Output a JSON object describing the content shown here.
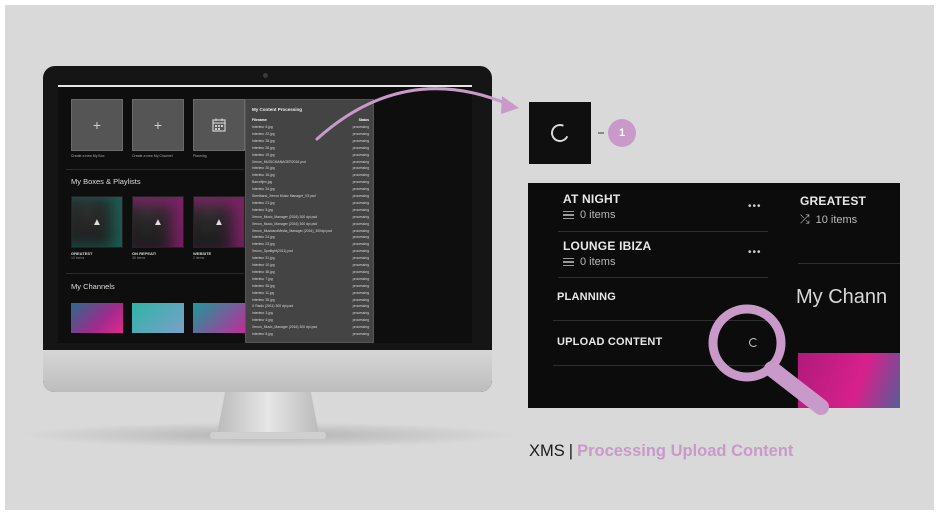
{
  "colors": {
    "accent": "#c99ac9",
    "background": "#d9d9d9",
    "screen": "#0e0e0e"
  },
  "screen": {
    "tiles": [
      {
        "icon": "+",
        "label": "Create a new My Box"
      },
      {
        "icon": "+",
        "label": "Create a new My Channel"
      },
      {
        "icon": "calendar-icon",
        "label": "Planning"
      }
    ],
    "boxes_heading": "My Boxes & Playlists",
    "boxes": [
      {
        "title": "GREATEST",
        "sub": "10 items"
      },
      {
        "title": "ON REPEAT!",
        "sub": "30 items"
      },
      {
        "title": "WEBSITE",
        "sub": "2 items"
      }
    ],
    "channels_heading": "My Channels",
    "panel": {
      "title": "My Content Processing",
      "header": {
        "name": "Filename",
        "status": "Status"
      },
      "files": [
        {
          "name": "Interieur 6.jpg",
          "status": "processing"
        },
        {
          "name": "Interieur 22.jpg",
          "status": "processing"
        },
        {
          "name": "Interieur 28.jpg",
          "status": "processing"
        },
        {
          "name": "Interieur 26.jpg",
          "status": "processing"
        },
        {
          "name": "Interieur 19.jpg",
          "status": "processing"
        },
        {
          "name": "Xenon_MUSICMANAGER2016.psd",
          "status": "processing"
        },
        {
          "name": "Interieur 20.jpg",
          "status": "processing"
        },
        {
          "name": "Interieur 16.jpg",
          "status": "processing"
        },
        {
          "name": "Barcelijen.jpg",
          "status": "processing"
        },
        {
          "name": "Interieur 34.jpg",
          "status": "processing"
        },
        {
          "name": "Steelband_Xenon Music Manager_V3.psd",
          "status": "processing"
        },
        {
          "name": "Interieur 21.jpg",
          "status": "processing"
        },
        {
          "name": "Interieur 5.jpg",
          "status": "processing"
        },
        {
          "name": "Xenon_Music_Manager (2016) 300 dpi.psd",
          "status": "processing"
        },
        {
          "name": "Xenon_Music_Manager (2016) 300 dpi.psd",
          "status": "processing"
        },
        {
          "name": "Xenon_MusicandMedia_Manager (2016)_300dpi.psd",
          "status": "processing"
        },
        {
          "name": "Interieur 24.jpg",
          "status": "processing"
        },
        {
          "name": "Interieur 23.jpg",
          "status": "processing"
        },
        {
          "name": "Xenon_Spotlight(2011).psd",
          "status": "processing"
        },
        {
          "name": "Interieur 31.jpg",
          "status": "processing"
        },
        {
          "name": "Interieur 10.jpg",
          "status": "processing"
        },
        {
          "name": "Interieur 38.jpg",
          "status": "processing"
        },
        {
          "name": "Interieur 7.jpg",
          "status": "processing"
        },
        {
          "name": "Interieur 36.jpg",
          "status": "processing"
        },
        {
          "name": "Interieur 11.jpg",
          "status": "processing"
        },
        {
          "name": "Interieur 35.jpg",
          "status": "processing"
        },
        {
          "name": "X Radio (2011) 300 dpi.psd",
          "status": "processing"
        },
        {
          "name": "Interieur 3.jpg",
          "status": "processing"
        },
        {
          "name": "Interieur 4.jpg",
          "status": "processing"
        },
        {
          "name": "Xenon_Music_Manager (2016) 300 dpi.psd",
          "status": "processing"
        },
        {
          "name": "Interieur 8.jpg",
          "status": "processing"
        }
      ]
    }
  },
  "callout": {
    "badge_number": "1"
  },
  "zoom": {
    "items": [
      {
        "title": "AT NIGHT",
        "sub": "0 items",
        "dots": "•••"
      },
      {
        "title": "LOUNGE IBIZA",
        "sub": "0 items",
        "dots": "•••"
      }
    ],
    "planning": "PLANNING",
    "upload": "UPLOAD CONTENT",
    "greatest": {
      "title": "GREATEST",
      "sub": "10 items"
    },
    "channels_heading": "My Chann"
  },
  "caption": {
    "brand": "XMS",
    "separator": "|",
    "subtitle": "Processing Upload Content"
  }
}
